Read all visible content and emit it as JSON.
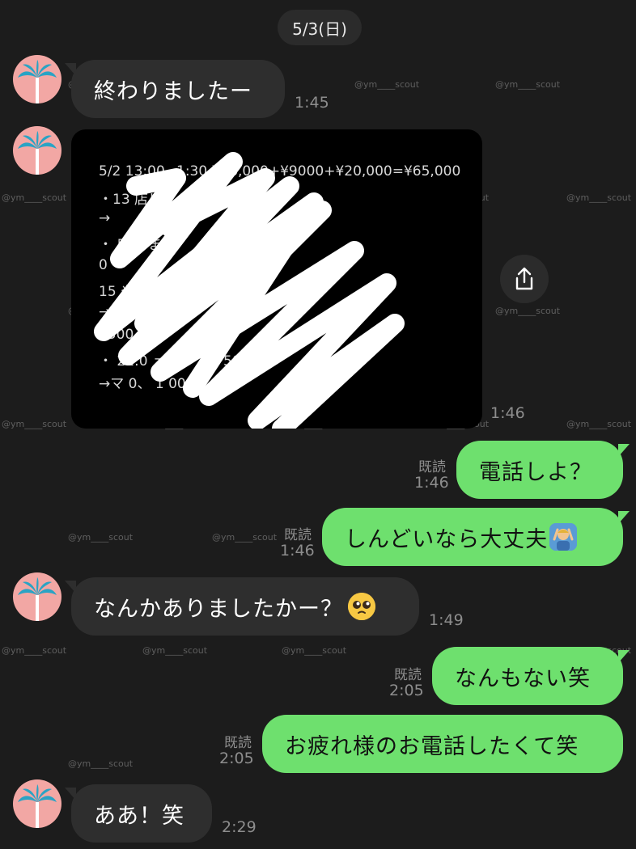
{
  "date_label": "5/3(日)",
  "watermark": "@ym____scout",
  "messages": [
    {
      "side": "in",
      "text": "終わりましたー",
      "time": "1:45"
    },
    {
      "side": "in",
      "type": "image",
      "time": "1:46",
      "image_lines": [
        "5/2 13:00~1:30 ¥36,000+¥9000+¥20,000=¥65,000",
        "・13        店リピ 1.3    日 7500",
        "→",
        "・       店      1       ま     0",
        "          0",
        "                          15       やま 7500",
        "→",
        "                                 7500",
        "・ 21:0               ェ     1.3      ト 750",
        "→マ           0、  1     00"
      ]
    },
    {
      "side": "out",
      "text": "電話しよ？",
      "read": "既読",
      "time": "1:46"
    },
    {
      "side": "out",
      "text": "しんどいなら大丈夫",
      "emoji": "person-gesturing-ok",
      "read": "既読",
      "time": "1:46"
    },
    {
      "side": "in",
      "text": "なんかありましたかー？",
      "emoji": "pleading-face",
      "time": "1:49"
    },
    {
      "side": "out",
      "text": "なんもない笑",
      "read": "既読",
      "time": "2:05"
    },
    {
      "side": "out",
      "text": "お疲れ様のお電話したくて笑",
      "read": "既読",
      "time": "2:05"
    },
    {
      "side": "in",
      "text": "ああ！笑",
      "time": "2:29"
    }
  ],
  "icons": {
    "avatar": "palm-tree-icon",
    "share": "share-icon"
  },
  "colors": {
    "background": "#1c1c1c",
    "incoming_bubble": "#2e2e2e",
    "outgoing_bubble": "#6ee06e",
    "avatar_bg": "#f2a7a4",
    "palm": "#2aa3c4"
  }
}
